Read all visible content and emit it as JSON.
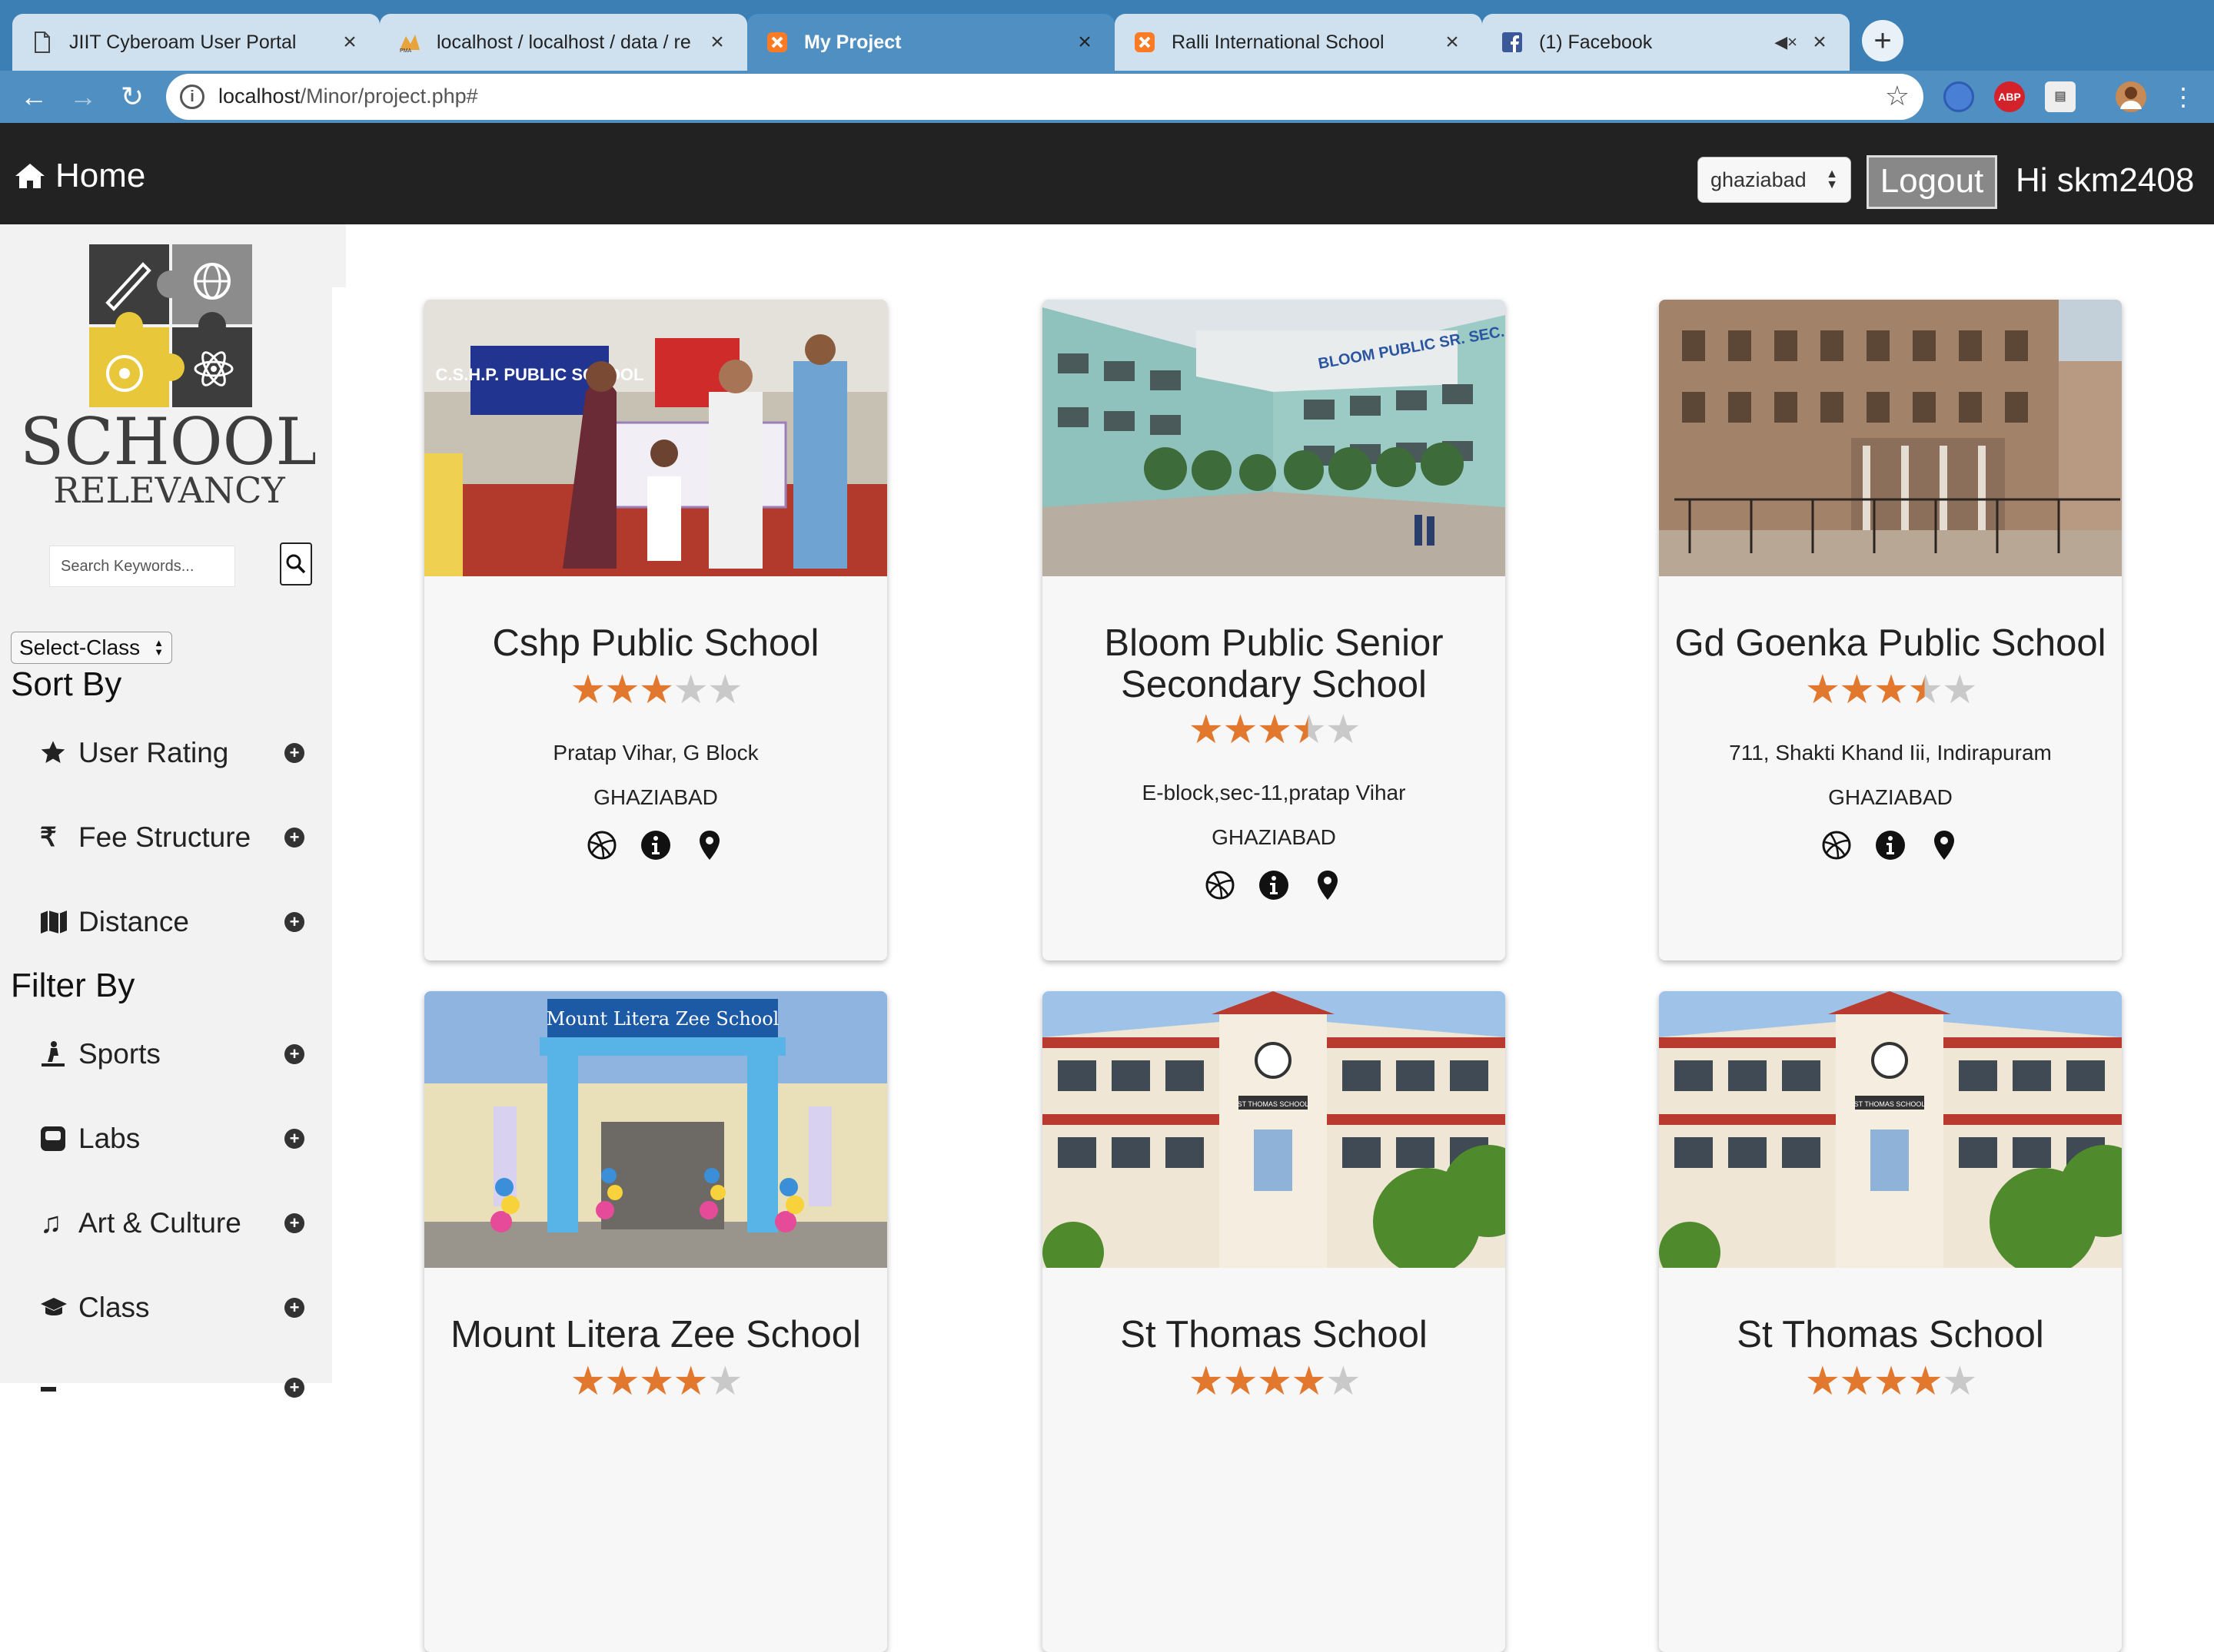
{
  "browser": {
    "tabs": [
      {
        "title": "JIIT Cyberoam User Portal",
        "icon": "document-icon"
      },
      {
        "title": "localhost / localhost / data / re",
        "icon": "phpmyadmin-icon"
      },
      {
        "title": "My Project",
        "icon": "xampp-icon",
        "active": true
      },
      {
        "title": "Ralli International School",
        "icon": "xampp-icon"
      },
      {
        "title": "(1) Facebook",
        "icon": "facebook-icon",
        "muted_audio": true
      }
    ],
    "url_host": "localhost",
    "url_path": "/Minor/project.php#",
    "extensions": [
      "sync-icon",
      "adblock-plus-icon",
      "extension-icon",
      "profile-avatar"
    ]
  },
  "header": {
    "home_label": "Home",
    "city_select_value": "ghaziabad",
    "logout_label": "Logout",
    "greeting": "Hi skm2408"
  },
  "sidebar": {
    "logo_line1": "SCHOOL",
    "logo_line2": "RELEVANCY",
    "search_placeholder": "Search Keywords...",
    "class_select_value": "Select-Class",
    "sort_title": "Sort By",
    "sort_items": [
      "User Rating",
      "Fee Structure",
      "Distance"
    ],
    "filter_title": "Filter By",
    "filter_items": [
      "Sports",
      "Labs",
      "Art & Culture",
      "Class"
    ]
  },
  "schools": [
    {
      "name": "Cshp Public School",
      "rating": 3,
      "address": "Pratap Vihar, G Block",
      "city": "GHAZIABAD"
    },
    {
      "name": "Bloom Public Senior Secondary School",
      "rating": 3.5,
      "address": "E-block,sec-11,pratap Vihar",
      "city": "GHAZIABAD"
    },
    {
      "name": "Gd Goenka Public School",
      "rating": 3.5,
      "address": "711, Shakti Khand Iii, Indirapuram",
      "city": "GHAZIABAD"
    },
    {
      "name": "Mount Litera Zee School",
      "rating": 4,
      "address": "",
      "city": "",
      "banner": "Mount Litera Zee School"
    },
    {
      "name": "St Thomas School",
      "rating": 4,
      "address": "",
      "city": "",
      "sign": "ST THOMAS SCHOOL"
    },
    {
      "name": "St Thomas School",
      "rating": 4,
      "address": "",
      "city": "",
      "sign": "ST THOMAS SCHOOL"
    }
  ],
  "photo_signs": {
    "cshp": "C.S.H.P. PUBLIC SCHOOL",
    "bloom": "BLOOM PUBLIC SR. SEC. SCHOOL"
  },
  "colors": {
    "tabbar": "#3c7fb4",
    "header": "#222222",
    "sidebar": "#f2f2f2",
    "star_on": "#e2782d",
    "star_off": "#c9c9c9"
  }
}
